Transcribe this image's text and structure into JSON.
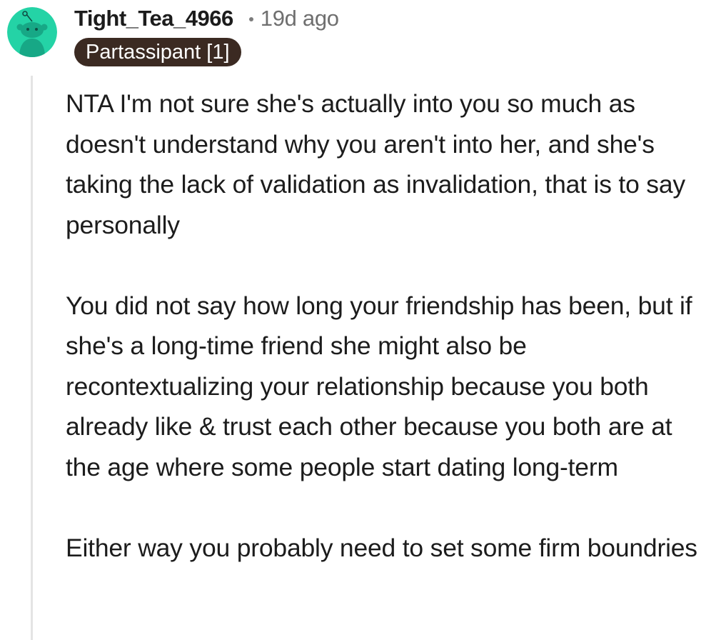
{
  "comment": {
    "author": "Tight_Tea_4966",
    "age": "19d ago",
    "flair": "Partassipant [1]",
    "avatar_icon": "reddit-snoo-icon",
    "avatar_color": "#24d3a6",
    "paragraphs": [
      "NTA I'm not sure she's actually into you so much as doesn't understand why you aren't into her, and she's taking the lack of validation as invalidation, that is to say personally",
      "You did not say how long your friendship has been, but if she's a long-time friend she might also be recontextualizing your relationship because you both already like & trust each other because you both are at the age where some people start dating long-term",
      "Either way you probably need to set some firm boundries"
    ]
  }
}
